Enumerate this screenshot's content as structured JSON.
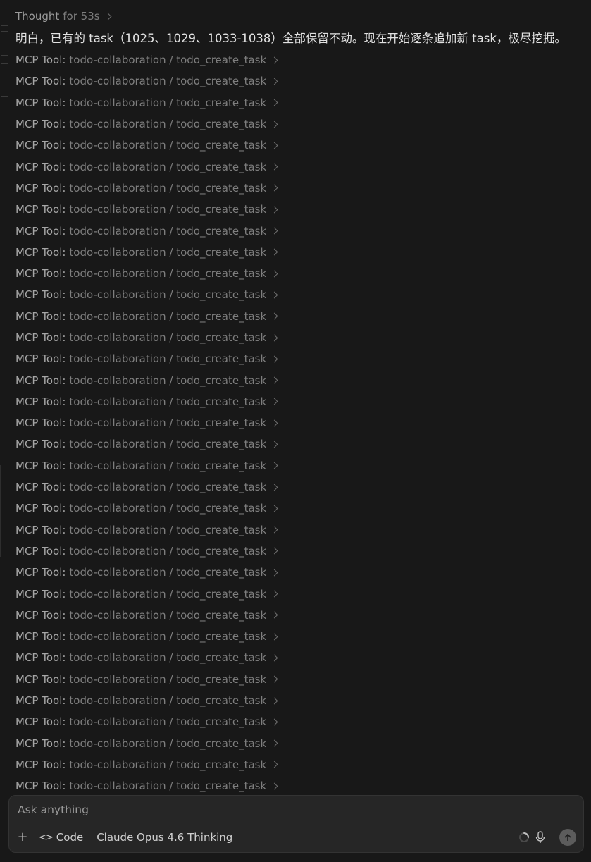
{
  "thought": {
    "label": "Thought",
    "duration": "for 53s"
  },
  "assistant_message": "明白，已有的 task（1025、1029、1033-1038）全部保留不动。现在开始逐条追加新 task，极尽挖掘。",
  "tool_calls": [
    {
      "prefix": "MCP Tool:",
      "name": "todo-collaboration / todo_create_task"
    },
    {
      "prefix": "MCP Tool:",
      "name": "todo-collaboration / todo_create_task"
    },
    {
      "prefix": "MCP Tool:",
      "name": "todo-collaboration / todo_create_task"
    },
    {
      "prefix": "MCP Tool:",
      "name": "todo-collaboration / todo_create_task"
    },
    {
      "prefix": "MCP Tool:",
      "name": "todo-collaboration / todo_create_task"
    },
    {
      "prefix": "MCP Tool:",
      "name": "todo-collaboration / todo_create_task"
    },
    {
      "prefix": "MCP Tool:",
      "name": "todo-collaboration / todo_create_task"
    },
    {
      "prefix": "MCP Tool:",
      "name": "todo-collaboration / todo_create_task"
    },
    {
      "prefix": "MCP Tool:",
      "name": "todo-collaboration / todo_create_task"
    },
    {
      "prefix": "MCP Tool:",
      "name": "todo-collaboration / todo_create_task"
    },
    {
      "prefix": "MCP Tool:",
      "name": "todo-collaboration / todo_create_task"
    },
    {
      "prefix": "MCP Tool:",
      "name": "todo-collaboration / todo_create_task"
    },
    {
      "prefix": "MCP Tool:",
      "name": "todo-collaboration / todo_create_task"
    },
    {
      "prefix": "MCP Tool:",
      "name": "todo-collaboration / todo_create_task"
    },
    {
      "prefix": "MCP Tool:",
      "name": "todo-collaboration / todo_create_task"
    },
    {
      "prefix": "MCP Tool:",
      "name": "todo-collaboration / todo_create_task"
    },
    {
      "prefix": "MCP Tool:",
      "name": "todo-collaboration / todo_create_task"
    },
    {
      "prefix": "MCP Tool:",
      "name": "todo-collaboration / todo_create_task"
    },
    {
      "prefix": "MCP Tool:",
      "name": "todo-collaboration / todo_create_task"
    },
    {
      "prefix": "MCP Tool:",
      "name": "todo-collaboration / todo_create_task"
    },
    {
      "prefix": "MCP Tool:",
      "name": "todo-collaboration / todo_create_task"
    },
    {
      "prefix": "MCP Tool:",
      "name": "todo-collaboration / todo_create_task"
    },
    {
      "prefix": "MCP Tool:",
      "name": "todo-collaboration / todo_create_task"
    },
    {
      "prefix": "MCP Tool:",
      "name": "todo-collaboration / todo_create_task"
    },
    {
      "prefix": "MCP Tool:",
      "name": "todo-collaboration / todo_create_task"
    },
    {
      "prefix": "MCP Tool:",
      "name": "todo-collaboration / todo_create_task"
    },
    {
      "prefix": "MCP Tool:",
      "name": "todo-collaboration / todo_create_task"
    },
    {
      "prefix": "MCP Tool:",
      "name": "todo-collaboration / todo_create_task"
    },
    {
      "prefix": "MCP Tool:",
      "name": "todo-collaboration / todo_create_task"
    },
    {
      "prefix": "MCP Tool:",
      "name": "todo-collaboration / todo_create_task"
    },
    {
      "prefix": "MCP Tool:",
      "name": "todo-collaboration / todo_create_task"
    },
    {
      "prefix": "MCP Tool:",
      "name": "todo-collaboration / todo_create_task"
    },
    {
      "prefix": "MCP Tool:",
      "name": "todo-collaboration / todo_create_task"
    },
    {
      "prefix": "MCP Tool:",
      "name": "todo-collaboration / todo_create_task"
    },
    {
      "prefix": "MCP Tool:",
      "name": "todo-collaboration / todo_create_task"
    }
  ],
  "composer": {
    "placeholder": "Ask anything",
    "mode_label": "Code",
    "model_label": "Claude Opus 4.6 Thinking",
    "icons": {
      "add": "plus-icon",
      "mode": "code-brackets-icon",
      "status": "loading-spinner-icon",
      "voice": "microphone-icon",
      "send": "arrow-up-icon"
    }
  },
  "colors": {
    "background": "#181818",
    "composer_background": "#262626",
    "message_text": "#e2e2e2",
    "tool_prefix": "#a6a6a6",
    "tool_name": "#7e7e7e"
  }
}
